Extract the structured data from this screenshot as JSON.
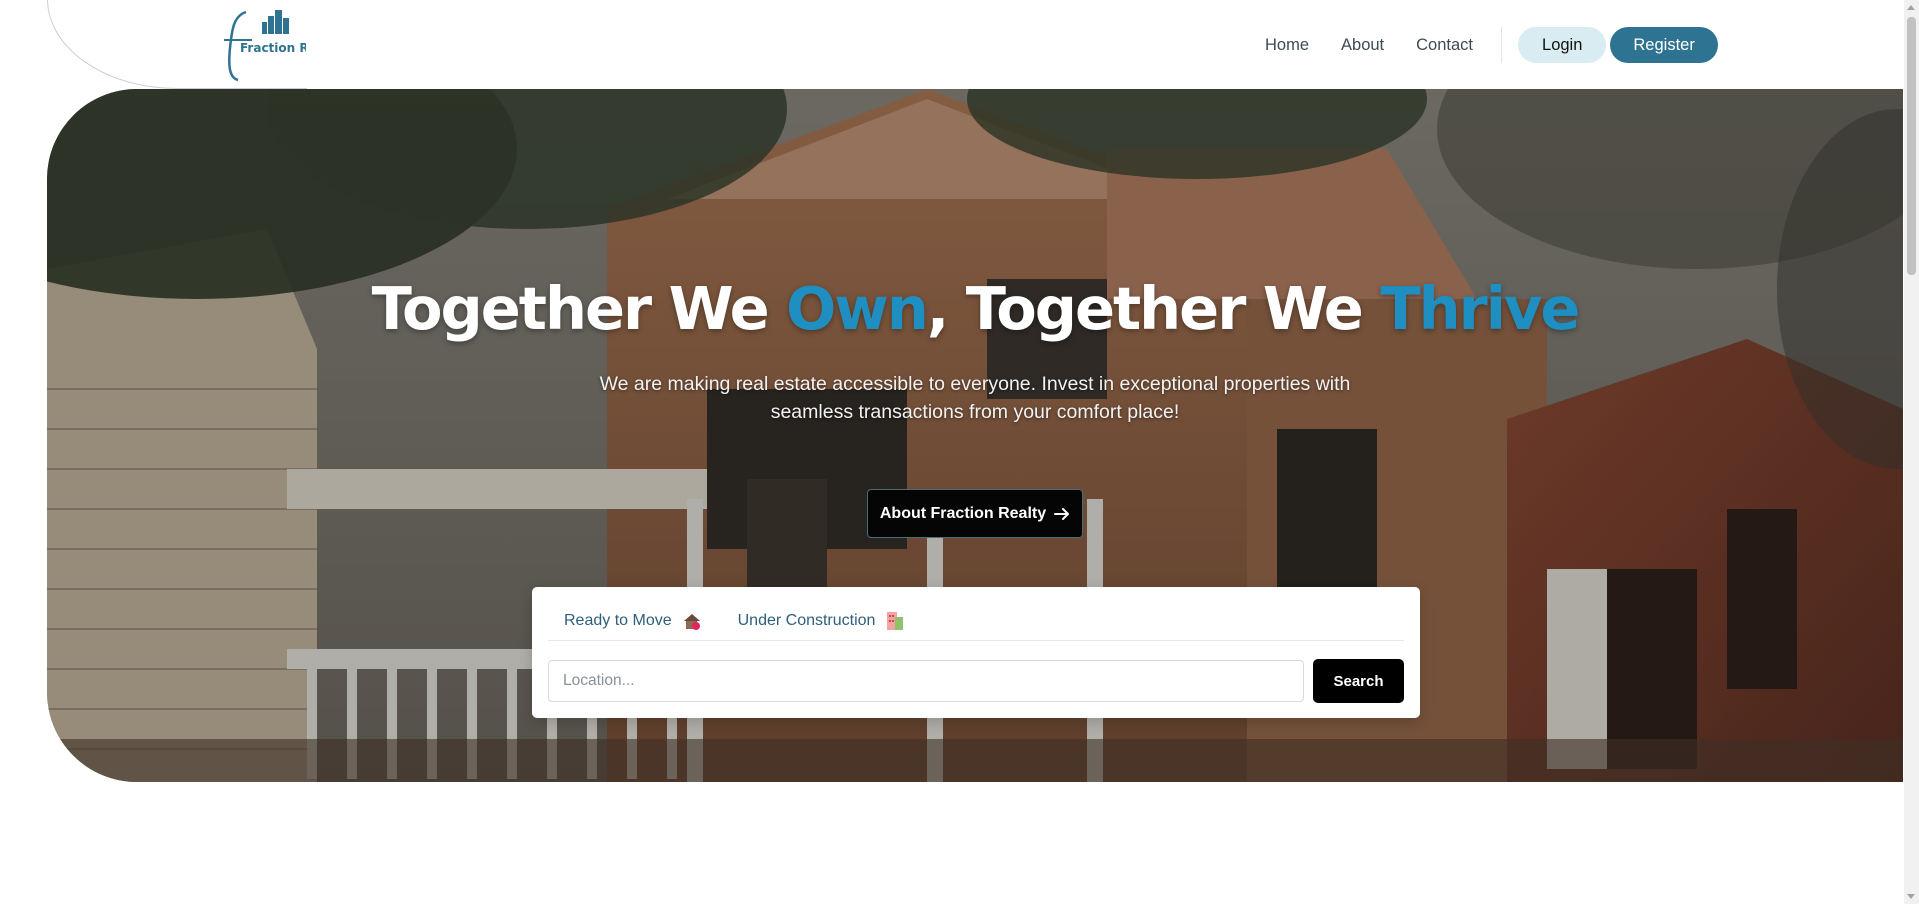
{
  "header": {
    "logo_alt": "Fraction Realty",
    "nav": [
      {
        "label": "Home"
      },
      {
        "label": "About"
      },
      {
        "label": "Contact"
      }
    ],
    "login_label": "Login",
    "register_label": "Register"
  },
  "hero": {
    "title_part1": "Together We ",
    "title_accent1": "Own",
    "title_part2": ", Together We ",
    "title_accent2": "Thrive",
    "subtitle": "We are making real estate accessible to everyone. Invest in exceptional properties with seamless transactions from your comfort place!",
    "about_button_label": "About Fraction Realty",
    "about_button_icon": "arrow-right-icon"
  },
  "search": {
    "tabs": [
      {
        "label": "Ready to Move",
        "icon": "house-icon"
      },
      {
        "label": "Under Construction",
        "icon": "building-icon"
      }
    ],
    "location_placeholder": "Location...",
    "search_label": "Search"
  },
  "colors": {
    "brand_teal": "#2e7391",
    "accent_blue": "#1e8fc0",
    "login_bg": "#d8ecf2"
  }
}
